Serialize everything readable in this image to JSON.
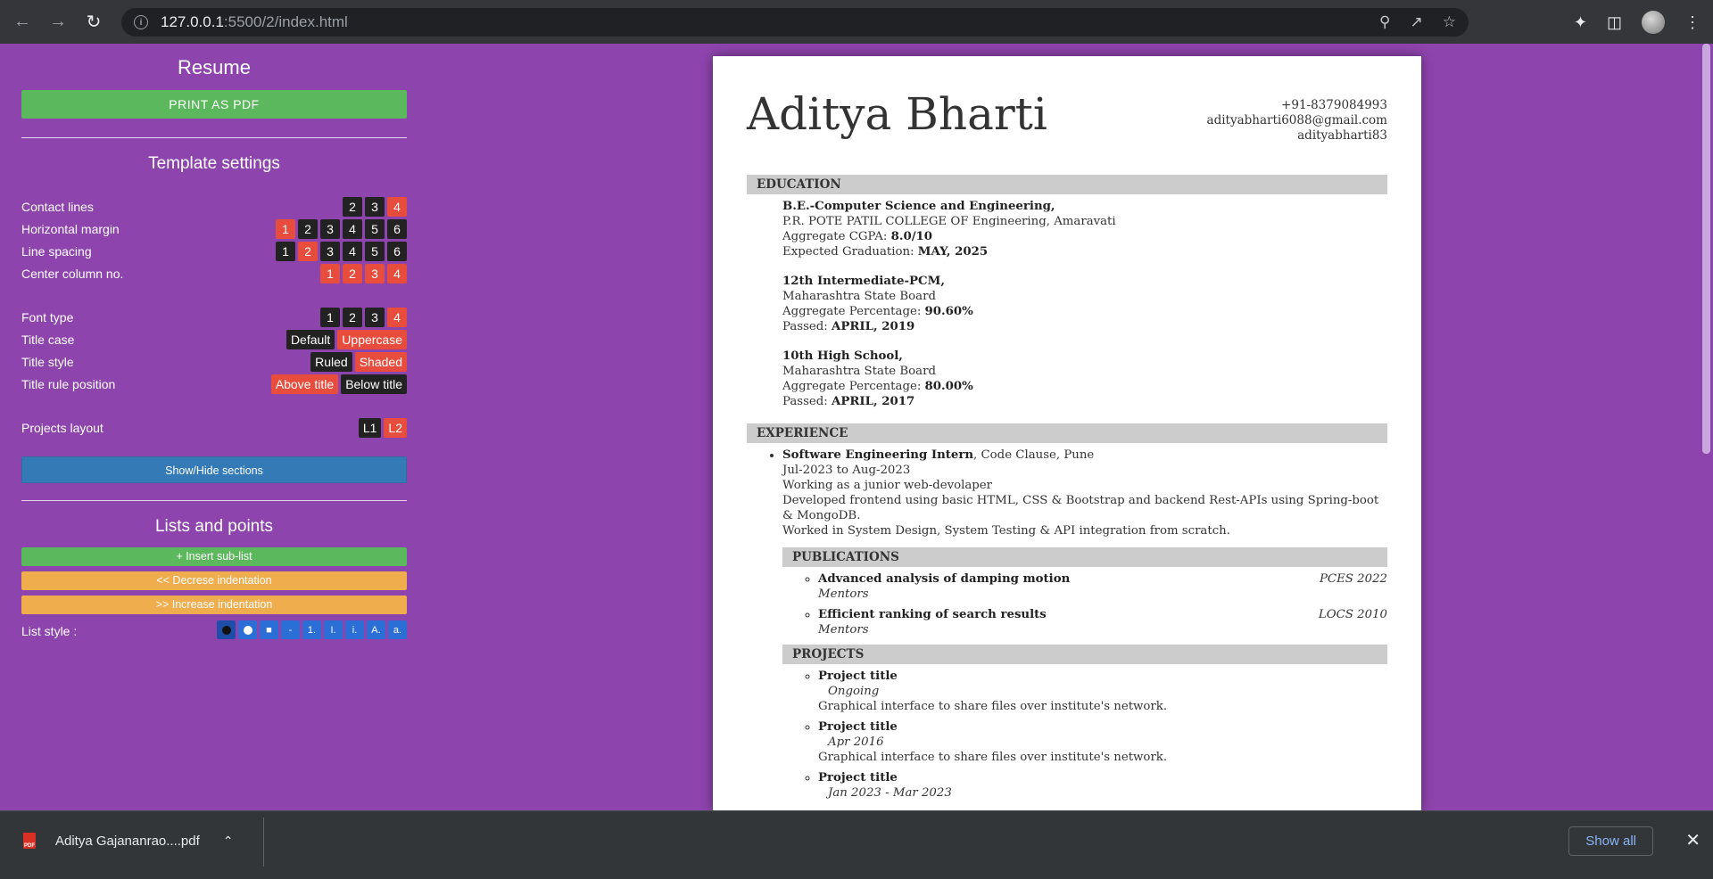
{
  "browser": {
    "url_host": "127.0.0.1",
    "url_rest": ":5500/2/index.html"
  },
  "sidebar": {
    "title": "Resume",
    "print_label": "PRINT AS PDF",
    "template_heading": "Template settings",
    "settings": [
      {
        "label": "Contact lines",
        "options": [
          "2",
          "3",
          "4"
        ],
        "active": [
          2
        ]
      },
      {
        "label": "Horizontal margin",
        "options": [
          "1",
          "2",
          "3",
          "4",
          "5",
          "6"
        ],
        "active": [
          0
        ]
      },
      {
        "label": "Line spacing",
        "options": [
          "1",
          "2",
          "3",
          "4",
          "5",
          "6"
        ],
        "active": [
          1
        ]
      },
      {
        "label": "Center column no.",
        "options": [
          "1",
          "2",
          "3",
          "4"
        ],
        "active": [
          0,
          1,
          2,
          3
        ]
      }
    ],
    "settings2": [
      {
        "label": "Font type",
        "options": [
          "1",
          "2",
          "3",
          "4"
        ],
        "active": [
          3
        ]
      },
      {
        "label": "Title case",
        "options": [
          "Default",
          "Uppercase"
        ],
        "active": [
          1
        ]
      },
      {
        "label": "Title style",
        "options": [
          "Ruled",
          "Shaded"
        ],
        "active": [
          1
        ]
      },
      {
        "label": "Title rule position",
        "options": [
          "Above title",
          "Below title"
        ],
        "active": [
          0
        ]
      }
    ],
    "projects_layout": {
      "label": "Projects layout",
      "options": [
        "L1",
        "L2"
      ],
      "active": [
        1
      ]
    },
    "show_hide_label": "Show/Hide sections",
    "lists_heading": "Lists and points",
    "insert_label": "+ Insert sub-list",
    "decrease_label": "<< Decrese indentation",
    "increase_label": ">> Increase indentation",
    "list_style_label": "List style :",
    "list_styles": [
      "●",
      "○",
      "■",
      "-",
      "1.",
      "I.",
      "i.",
      "A.",
      "a."
    ]
  },
  "resume": {
    "name": "Aditya Bharti",
    "phone": "+91-8379084993",
    "email": "adityabharti6088@gmail.com",
    "handle": "adityabharti83",
    "education_title": "EDUCATION",
    "education": [
      {
        "degree": "B.E.-Computer Science and Engineering,",
        "school": "P.R. POTE PATIL COLLEGE OF Engineering, Amaravati",
        "metric_label": "Aggregate CGPA: ",
        "metric_value": "8.0/10",
        "date_label": "Expected Graduation: ",
        "date_value": "MAY, 2025"
      },
      {
        "degree": "12th Intermediate-PCM,",
        "school": "Maharashtra State Board",
        "metric_label": "Aggregate Percentage: ",
        "metric_value": "90.60%",
        "date_label": "Passed: ",
        "date_value": "APRIL, 2019"
      },
      {
        "degree": "10th High School,",
        "school": "Maharashtra State Board",
        "metric_label": "Aggregate Percentage: ",
        "metric_value": "80.00%",
        "date_label": "Passed: ",
        "date_value": "APRIL, 2017"
      }
    ],
    "experience_title": "EXPERIENCE",
    "experience": {
      "role": "Software Engineering Intern",
      "company": ", Code Clause, Pune",
      "dates": "Jul-2023 to Aug-2023",
      "lines": [
        "Working as a junior web-devolaper",
        "Developed frontend using basic HTML, CSS & Bootstrap and backend Rest-APIs using Spring-boot & MongoDB.",
        "Worked in System Design, System Testing & API integration from scratch."
      ]
    },
    "publications_title": "PUBLICATIONS",
    "publications": [
      {
        "title": "Advanced analysis of damping motion",
        "venue": "PCES 2022",
        "note": "Mentors"
      },
      {
        "title": "Efficient ranking of search results",
        "venue": "LOCS 2010",
        "note": "Mentors"
      }
    ],
    "projects_title": "PROJECTS",
    "projects": [
      {
        "title": "Project title",
        "date": "Ongoing",
        "desc": "Graphical interface to share files over institute's network."
      },
      {
        "title": "Project title",
        "date": "Apr 2016",
        "desc": "Graphical interface to share files over institute's network."
      },
      {
        "title": "Project title",
        "date": "Jan 2023 - Mar 2023",
        "desc": ""
      }
    ]
  },
  "downloads": {
    "file_name": "Aditya Gajananrao....pdf",
    "file_type": "PDF",
    "show_all_label": "Show all"
  }
}
